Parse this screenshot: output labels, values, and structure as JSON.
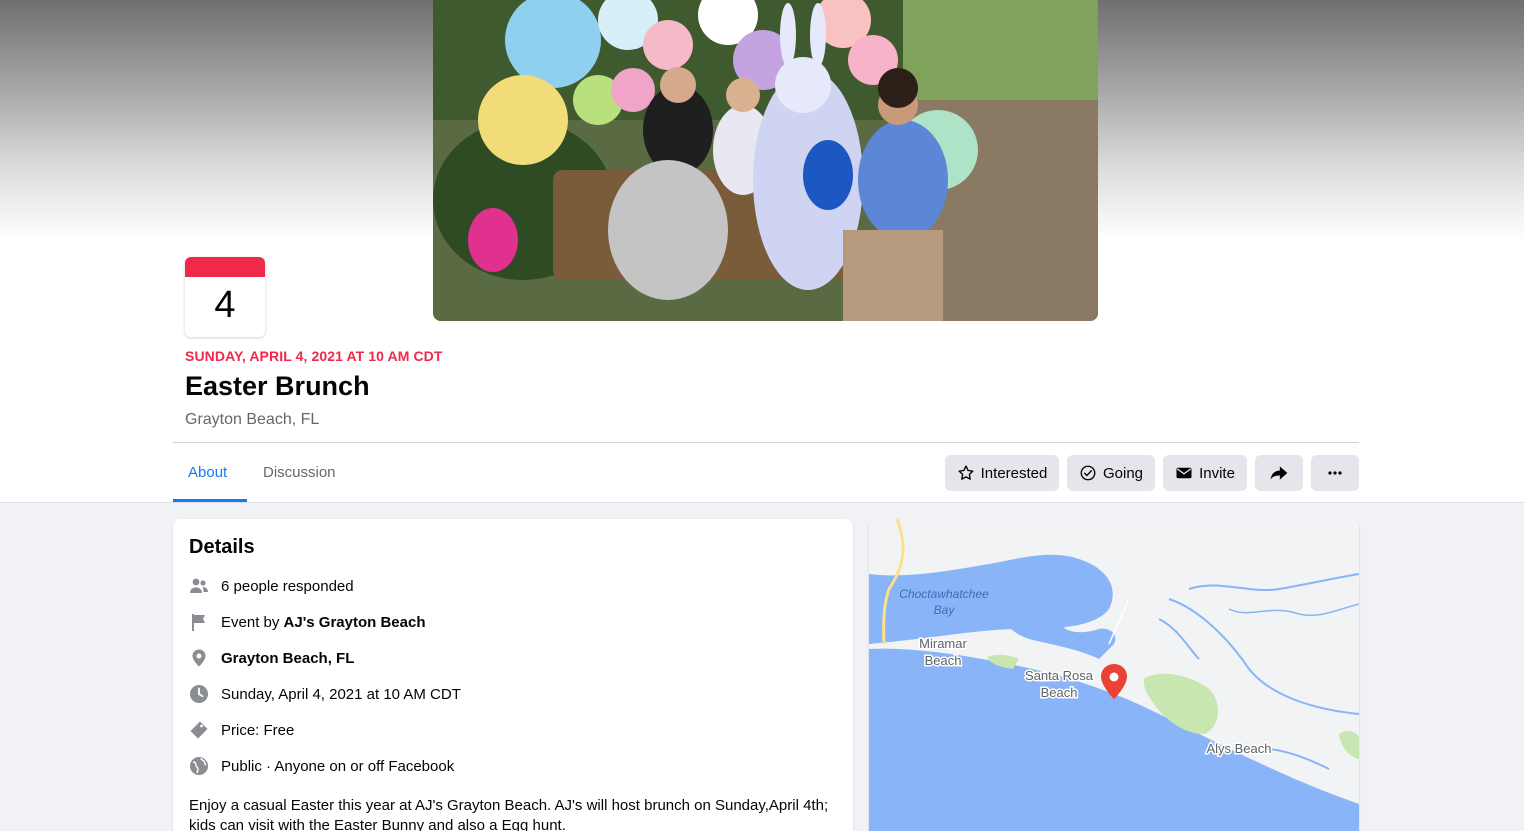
{
  "event": {
    "day_number": "4",
    "date_line": "SUNDAY, APRIL 4, 2021 AT 10 AM CDT",
    "title": "Easter Brunch",
    "location": "Grayton Beach, FL"
  },
  "tabs": [
    {
      "label": "About",
      "active": true
    },
    {
      "label": "Discussion",
      "active": false
    }
  ],
  "actions": {
    "interested": "Interested",
    "going": "Going",
    "invite": "Invite",
    "share_icon": "share-arrow-icon",
    "more_icon": "more-icon"
  },
  "details": {
    "heading": "Details",
    "responded": "6 people responded",
    "event_by_prefix": "Event by ",
    "event_by_name": "AJ's Grayton Beach",
    "place": "Grayton Beach, FL",
    "datetime": "Sunday, April 4, 2021 at 10 AM CDT",
    "price": "Price: Free",
    "privacy": "Public · Anyone on or off Facebook",
    "description": "Enjoy a casual Easter this year at AJ's Grayton Beach. AJ's will host brunch on Sunday,April 4th; kids can visit with the Easter Bunny and also a Egg hunt."
  },
  "map": {
    "labels": {
      "bay_line1": "Choctawhatchee",
      "bay_line2": "Bay",
      "miramar_line1": "Miramar",
      "miramar_line2": "Beach",
      "santa_rosa_line1": "Santa Rosa",
      "santa_rosa_line2": "Beach",
      "alys": "Alys Beach"
    }
  },
  "colors": {
    "accent": "#1877f2",
    "event_red": "#f02849",
    "water": "#8ab4f8",
    "land": "#f1f3f4",
    "park": "#c8e6b0",
    "pin": "#ea4335"
  }
}
